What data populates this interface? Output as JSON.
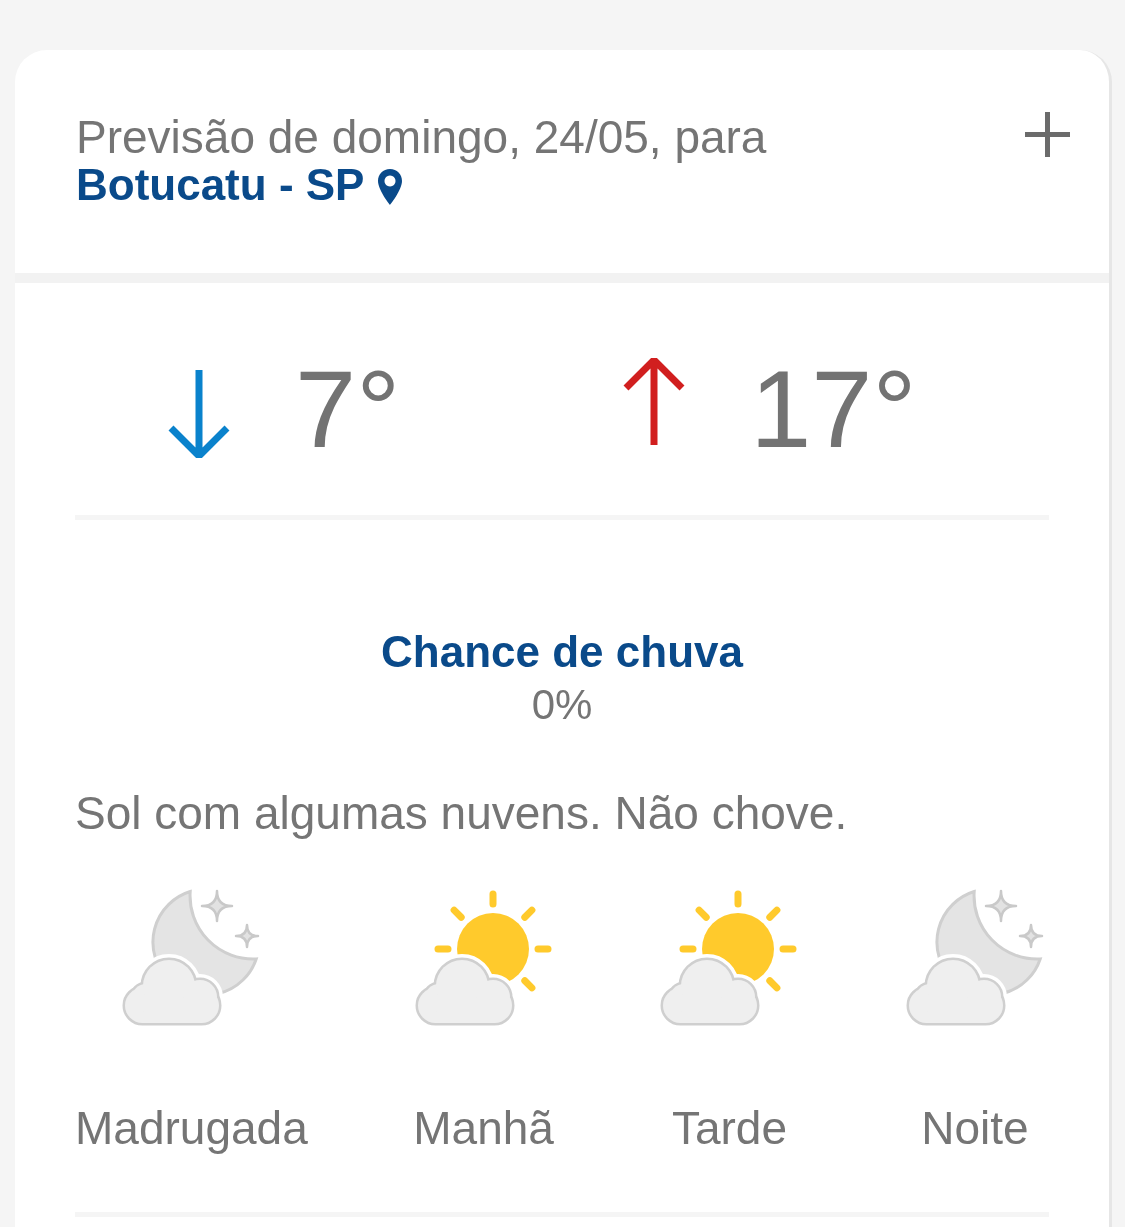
{
  "header": {
    "title": "Previsão de domingo, 24/05, para",
    "location": "Botucatu - SP"
  },
  "temperatures": [
    {
      "kind": "min",
      "value": "7°"
    },
    {
      "kind": "max",
      "value": "17°"
    }
  ],
  "rain": {
    "label": "Chance de chuva",
    "value": "0%"
  },
  "summary": "Sol com algumas nuvens. Não chove.",
  "periods": [
    {
      "label": "Madrugada",
      "kind": "night"
    },
    {
      "label": "Manhã",
      "kind": "day"
    },
    {
      "label": "Tarde",
      "kind": "day"
    },
    {
      "label": "Noite",
      "kind": "night"
    }
  ]
}
